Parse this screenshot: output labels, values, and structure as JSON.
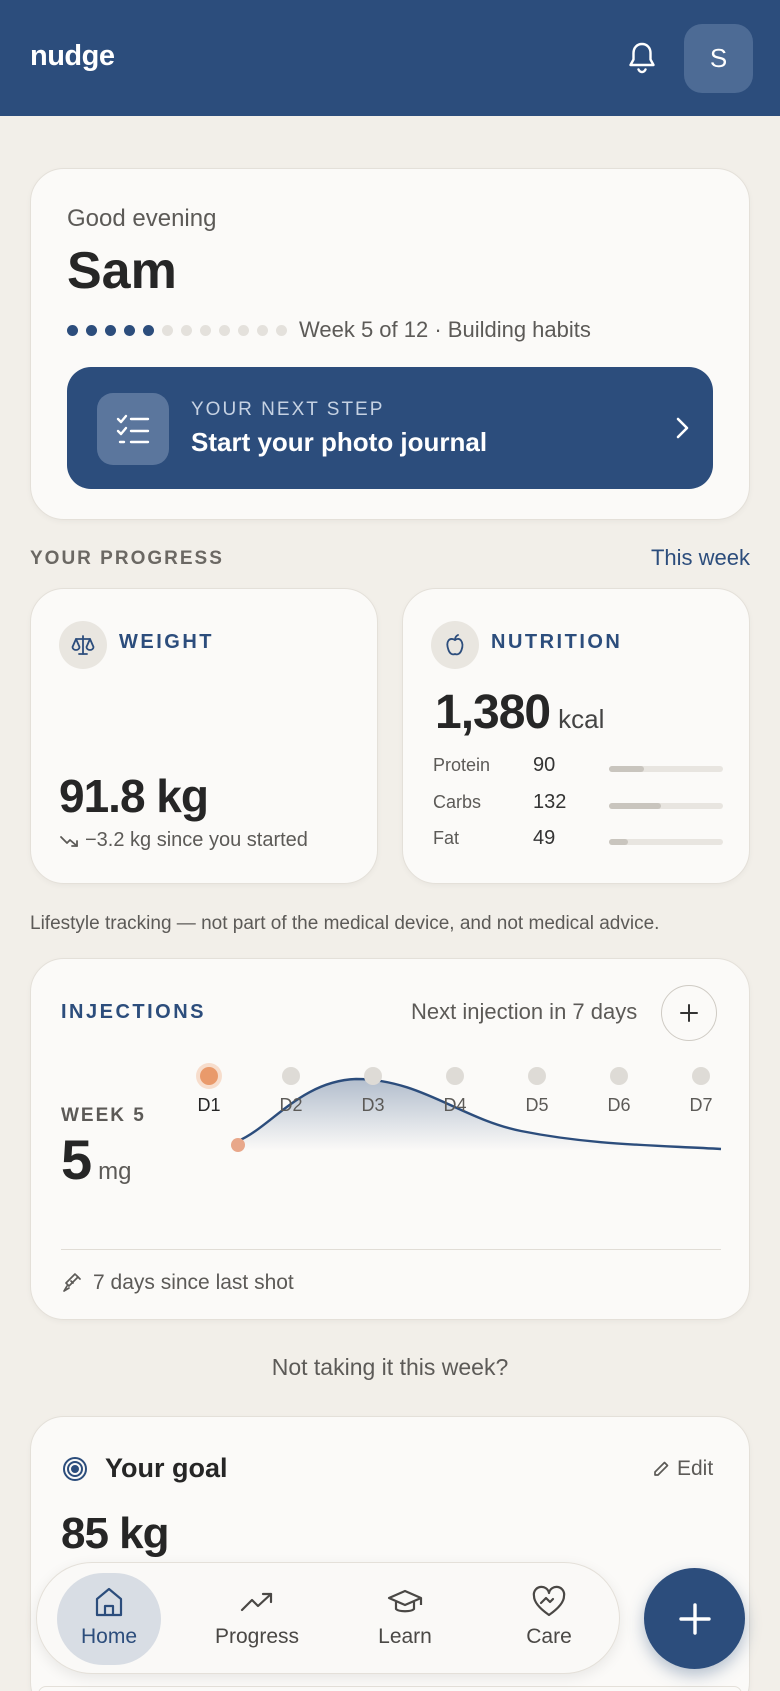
{
  "header": {
    "brand": "nudge",
    "avatar_initial": "S",
    "bell_icon": "bell-icon"
  },
  "greeting": {
    "hello": "Good evening",
    "name": "Sam",
    "week_current": 5,
    "week_total": 12,
    "week_text": "Week 5 of 12 · Building habits",
    "next_step_label": "YOUR NEXT STEP",
    "next_step_text": "Start your photo journal",
    "next_step_icon": "checklist-icon"
  },
  "progress": {
    "section_title": "YOUR PROGRESS",
    "period_link": "This week",
    "weight": {
      "label": "WEIGHT",
      "icon": "scale-icon",
      "value": "91.8 kg",
      "change": "−3.2 kg since you started"
    },
    "nutrition": {
      "label": "NUTRITION",
      "icon": "apple-icon",
      "kcal": "1,380",
      "kcal_unit": "kcal",
      "macros": [
        {
          "name": "Protein",
          "value": "90",
          "fill": 0.31
        },
        {
          "name": "Carbs",
          "value": "132",
          "fill": 0.46
        },
        {
          "name": "Fat",
          "value": "49",
          "fill": 0.17
        }
      ]
    }
  },
  "disclaimer": "Lifestyle tracking — not part of the medical device, and not medical advice.",
  "injections": {
    "title": "INJECTIONS",
    "next_text": "Next injection in 7 days",
    "week_label": "WEEK 5",
    "dose_value": "5",
    "dose_unit": "mg",
    "days": [
      "D1",
      "D2",
      "D3",
      "D4",
      "D5",
      "D6",
      "D7"
    ],
    "current_day": 0,
    "last_shot": "7 days since last shot",
    "accent_color": "#e99a6b"
  },
  "skip_link": "Not taking it this week?",
  "goal": {
    "title": "Your goal",
    "edit_label": "Edit",
    "value": "85 kg"
  },
  "nav": {
    "items": [
      {
        "label": "Home",
        "icon": "home-icon",
        "active": true
      },
      {
        "label": "Progress",
        "icon": "trend-icon",
        "active": false
      },
      {
        "label": "Learn",
        "icon": "graduation-cap-icon",
        "active": false
      },
      {
        "label": "Care",
        "icon": "heart-hands-icon",
        "active": false
      }
    ],
    "fab_icon": "plus-icon"
  },
  "colors": {
    "primary": "#2c4d7c",
    "background": "#f2efe9",
    "card": "#fbfaf8"
  }
}
